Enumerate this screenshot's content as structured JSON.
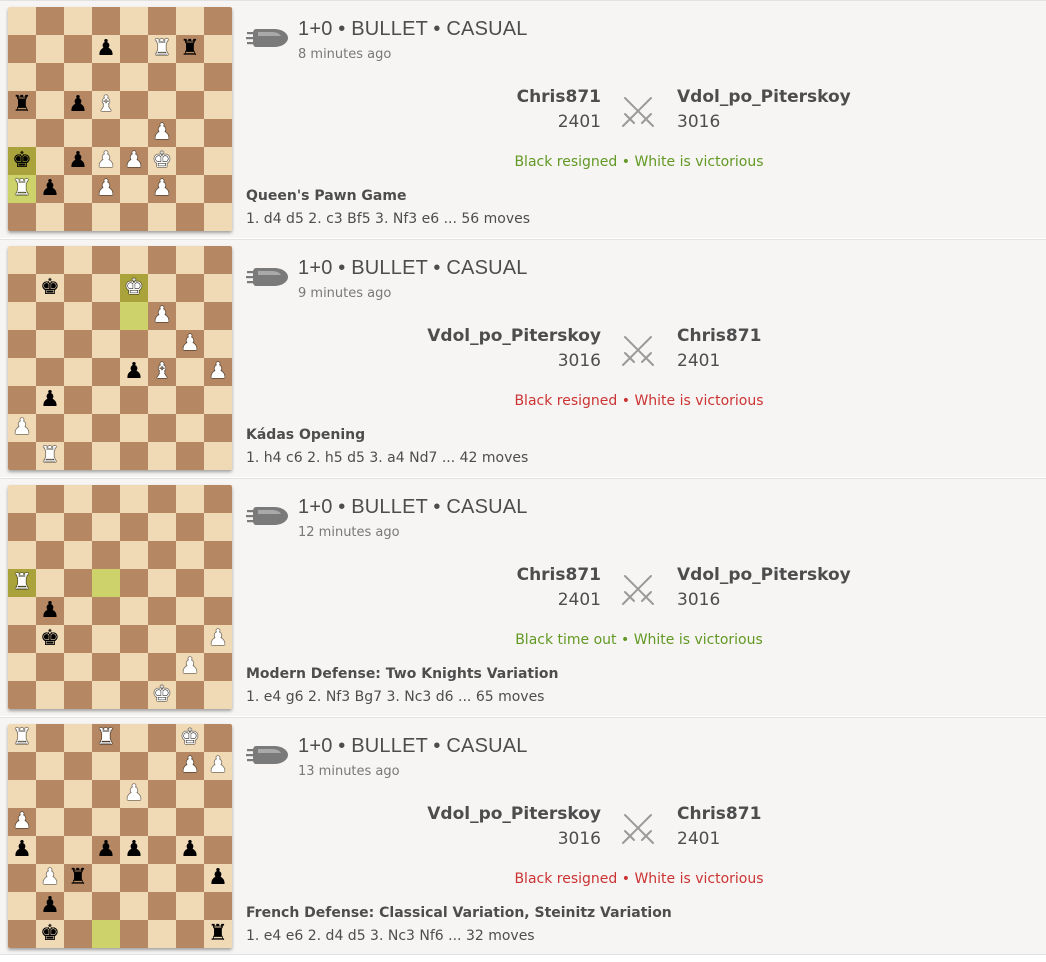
{
  "colors": {
    "light_square": "#f0d9b5",
    "dark_square": "#b58863",
    "highlight": "#cdd26a",
    "win_text": "#629924",
    "loss_text": "#cc3333"
  },
  "icons": {
    "speed": "bullet-icon",
    "versus": "crossed-swords-icon"
  },
  "games": [
    {
      "title": "1+0 • BULLET • CASUAL",
      "time_ago": "8 minutes ago",
      "left_player": "Chris871",
      "left_rating": "2401",
      "right_player": "Vdol_po_Piterskoy",
      "right_rating": "3016",
      "result": "Black resigned • White is victorious",
      "result_kind": "win",
      "opening": "Queen's Pawn Game",
      "moves": "1. d4 d5 2. c3 Bf5 3. Nf3 e6 ... 56 moves",
      "board": {
        "highlights": [
          "a6",
          "a7"
        ],
        "pieces": {
          "a4": "br",
          "a6": "bk",
          "a7": "wr",
          "b7": "bp",
          "c4": "bp",
          "c6": "bp",
          "d2": "bp",
          "d4": "wb",
          "d6": "wp",
          "d7": "wp",
          "e6": "wp",
          "f2": "wr",
          "f5": "wp",
          "f6": "wk",
          "f7": "wp",
          "g2": "br"
        }
      }
    },
    {
      "title": "1+0 • BULLET • CASUAL",
      "time_ago": "9 minutes ago",
      "left_player": "Vdol_po_Piterskoy",
      "left_rating": "3016",
      "right_player": "Chris871",
      "right_rating": "2401",
      "result": "Black resigned • White is victorious",
      "result_kind": "loss",
      "opening": "Kádas Opening",
      "moves": "1. h4 c6 2. h5 d5 3. a4 Nd7 ... 42 moves",
      "board": {
        "highlights": [
          "e2",
          "e3"
        ],
        "pieces": {
          "b2": "bk",
          "e2": "wk",
          "f3": "wp",
          "g4": "wp",
          "e5": "bp",
          "f5": "wb",
          "h5": "wp",
          "b6": "bp",
          "a7": "wp",
          "b8": "wr"
        }
      }
    },
    {
      "title": "1+0 • BULLET • CASUAL",
      "time_ago": "12 minutes ago",
      "left_player": "Chris871",
      "left_rating": "2401",
      "right_player": "Vdol_po_Piterskoy",
      "right_rating": "3016",
      "result": "Black time out • White is victorious",
      "result_kind": "win",
      "opening": "Modern Defense: Two Knights Variation",
      "moves": "1. e4 g6 2. Nf3 Bg7 3. Nc3 d6 ... 65 moves",
      "board": {
        "highlights": [
          "a4",
          "d4"
        ],
        "pieces": {
          "a4": "wr",
          "b5": "bp",
          "b6": "bk",
          "h6": "wp",
          "g7": "wp",
          "f8": "wk"
        }
      }
    },
    {
      "title": "1+0 • BULLET • CASUAL",
      "time_ago": "13 minutes ago",
      "left_player": "Vdol_po_Piterskoy",
      "left_rating": "3016",
      "right_player": "Chris871",
      "right_rating": "2401",
      "result": "Black resigned • White is victorious",
      "result_kind": "loss",
      "opening": "French Defense: Classical Variation, Steinitz Variation",
      "moves": "1. e4 e6 2. d4 d5 3. Nc3 Nf6 ... 32 moves",
      "board": {
        "highlights": [
          "d8"
        ],
        "pieces": {
          "a1": "wr",
          "d1": "wr",
          "g1": "wk",
          "g2": "wp",
          "h2": "wp",
          "e3": "wp",
          "a4": "wp",
          "a5": "bp",
          "d5": "bp",
          "e5": "bp",
          "g5": "bp",
          "b6": "wp",
          "c6": "br",
          "h6": "bp",
          "b7": "bp",
          "b8": "bk",
          "h8": "br"
        }
      }
    }
  ]
}
